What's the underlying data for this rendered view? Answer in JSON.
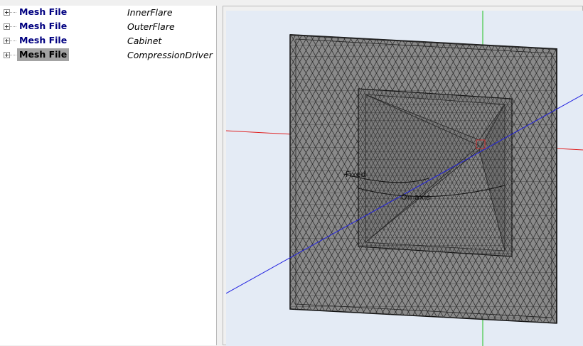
{
  "tree": {
    "items": [
      {
        "type": "Mesh File",
        "name": "InnerFlare",
        "selected": false
      },
      {
        "type": "Mesh File",
        "name": "OuterFlare",
        "selected": false
      },
      {
        "type": "Mesh File",
        "name": "Cabinet",
        "selected": false
      },
      {
        "type": "Mesh File",
        "name": "CompressionDriver",
        "selected": true
      }
    ]
  },
  "viewport": {
    "background_color": "#e4ebf5",
    "mesh_color": "#8a8a8a",
    "axis_colors": {
      "x": "#e02020",
      "y": "#20c020",
      "z": "#2020e0"
    },
    "labels": {
      "source": "Fixed",
      "observation": "On axis"
    }
  }
}
